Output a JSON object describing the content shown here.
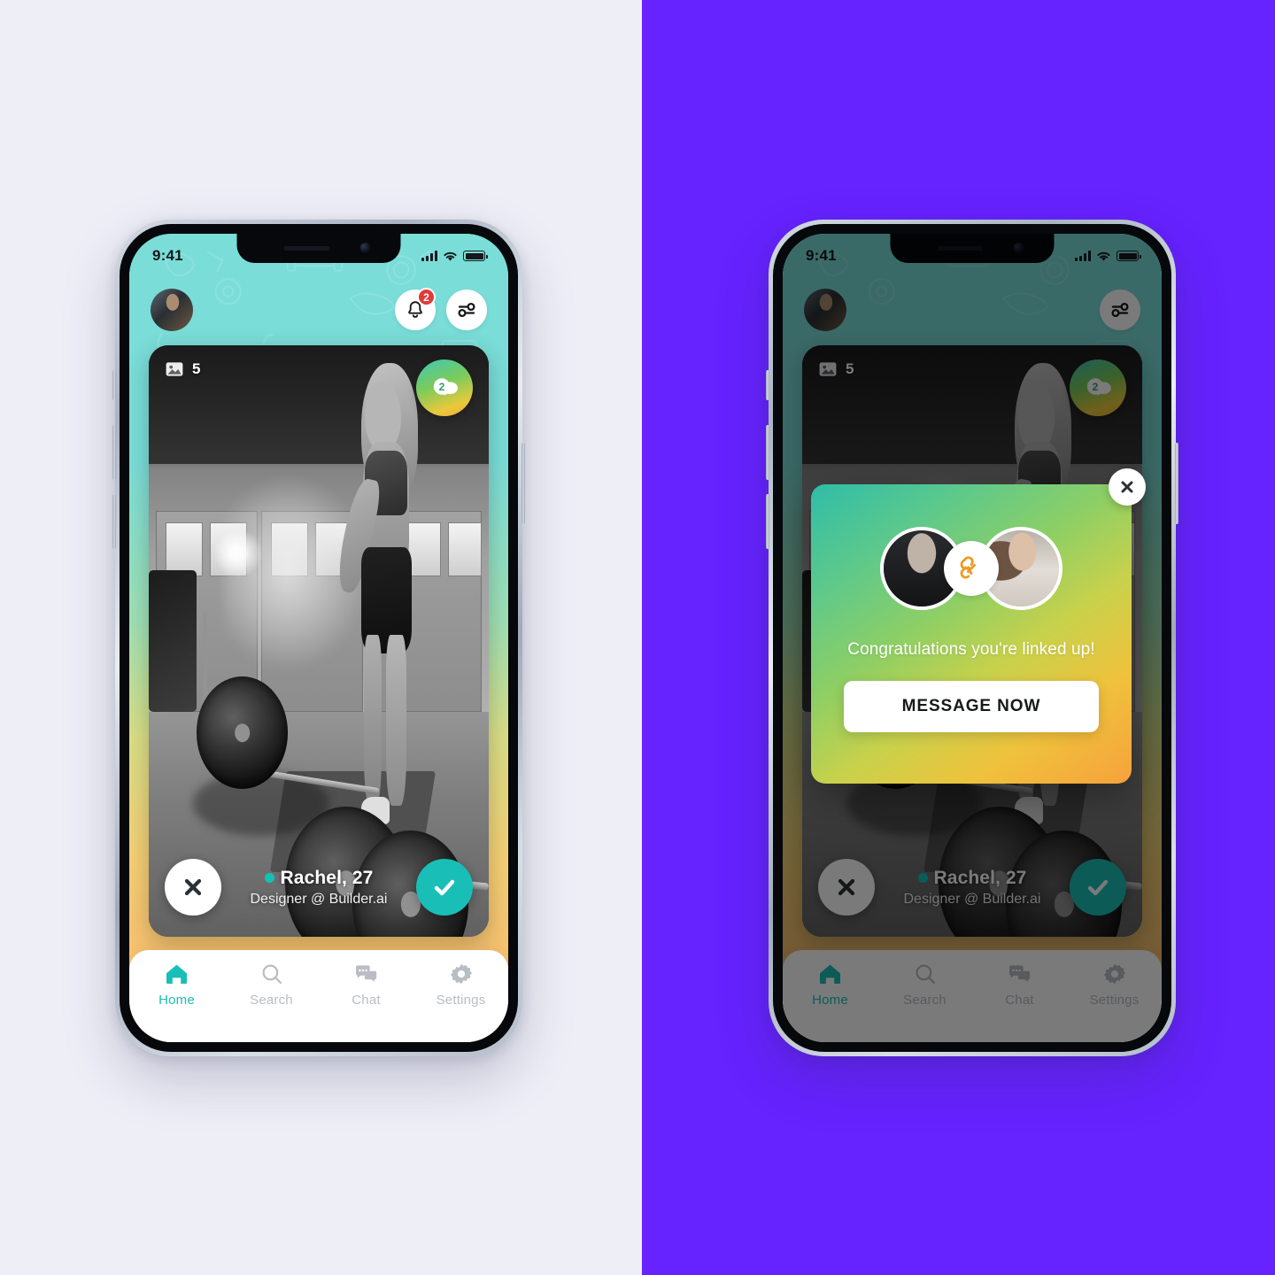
{
  "meta": {
    "left_panel_bg": "#EDEEF6",
    "right_panel_bg": "#6622FF",
    "accent_teal": "#19BFB6",
    "accent_orange": "#F2A93B",
    "badge_red": "#E23A3A"
  },
  "status_bar": {
    "time": "9:41",
    "signal_icon": "cellular-signal-icon",
    "wifi_icon": "wifi-icon",
    "battery_icon": "battery-icon"
  },
  "header": {
    "avatar_icon": "user-avatar",
    "notifications": {
      "icon": "bell-icon",
      "badge_count": "2"
    },
    "filter": {
      "icon": "filter-sliders-icon"
    }
  },
  "card": {
    "photo_count": "5",
    "photo_count_icon": "image-icon",
    "chat_badge": {
      "icon": "chat-bubbles-icon",
      "count": "2"
    },
    "profile": {
      "name": "Rachel, 27",
      "role": "Designer  @ Builder.ai",
      "online": true
    },
    "actions": {
      "nope_icon": "close-x-icon",
      "like_icon": "check-tick-icon"
    }
  },
  "tabbar": {
    "items": [
      {
        "label": "Home",
        "icon": "home-icon",
        "active": true
      },
      {
        "label": "Search",
        "icon": "search-icon",
        "active": false
      },
      {
        "label": "Chat",
        "icon": "chat-icon",
        "active": false
      },
      {
        "label": "Settings",
        "icon": "gear-icon",
        "active": false
      }
    ]
  },
  "match_modal": {
    "close_icon": "close-x-icon",
    "link_icon": "chain-link-icon",
    "avatar_left": "match-avatar-man",
    "avatar_right": "match-avatar-woman",
    "message": "Congratulations you're linked up!",
    "cta_label": "MESSAGE NOW"
  }
}
